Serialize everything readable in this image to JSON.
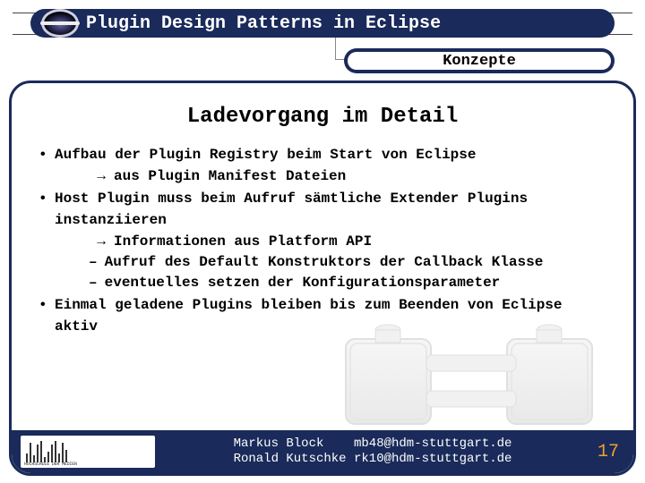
{
  "title": "Plugin Design Patterns in Eclipse",
  "section_chip": "Konzepte",
  "heading": "Ladevorgang im Detail",
  "bullets": [
    {
      "text": "Aufbau der Plugin Registry beim Start von Eclipse",
      "arrows": [
        "aus Plugin Manifest Dateien"
      ],
      "dashes": []
    },
    {
      "text": "Host Plugin muss beim Aufruf sämtliche Extender Plugins instanziieren",
      "arrows": [
        "Informationen aus Platform API"
      ],
      "dashes": [
        "Aufruf des Default Konstruktors der Callback Klasse",
        "eventuelles setzen der Konfigurationsparameter"
      ]
    },
    {
      "text": "Einmal geladene Plugins bleiben bis zum Beenden von Eclipse aktiv",
      "arrows": [],
      "dashes": []
    }
  ],
  "footer": {
    "authors": [
      {
        "name": "Markus Block",
        "email": "mb48@hdm-stuttgart.de"
      },
      {
        "name": "Ronald Kutschke",
        "email": "rk10@hdm-stuttgart.de"
      }
    ],
    "institution_caption": "HOCHSCHULE DER MEDIEN"
  },
  "page_number": "17"
}
